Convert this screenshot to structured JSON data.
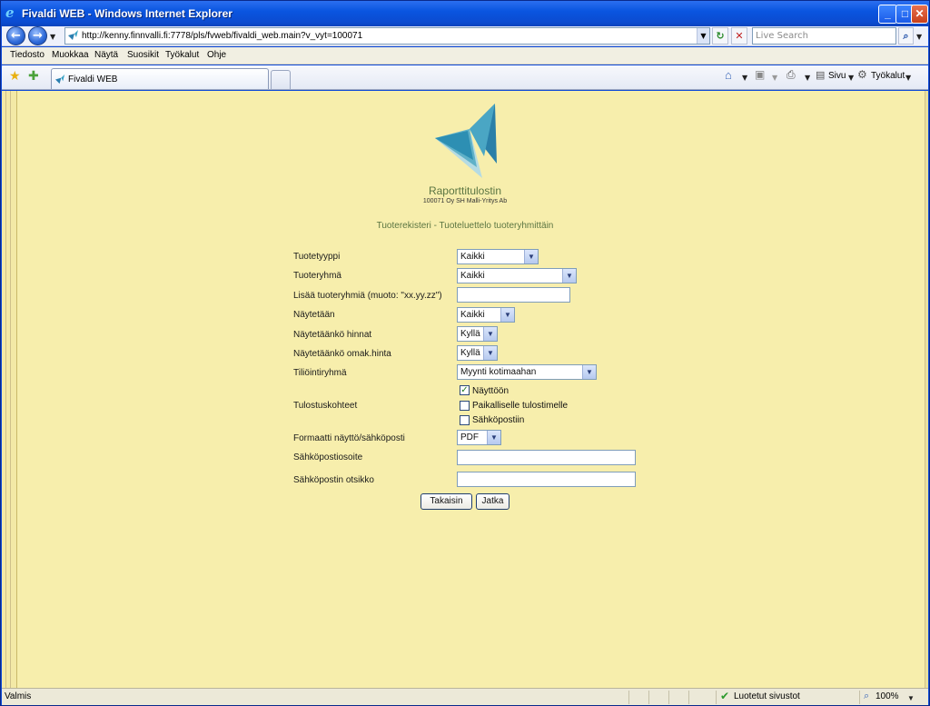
{
  "window": {
    "title": "Fivaldi WEB - Windows Internet Explorer"
  },
  "address": {
    "url": "http://kenny.finnvalli.fi:7778/pls/fvweb/fivaldi_web.main?v_vyt=100071",
    "search_placeholder": "Live Search"
  },
  "menu": {
    "items": [
      "Tiedosto",
      "Muokkaa",
      "Näytä",
      "Suosikit",
      "Työkalut",
      "Ohje"
    ]
  },
  "tabs": {
    "active_label": "Fivaldi WEB"
  },
  "commandbar": {
    "page_label": "Sivu",
    "tools_label": "Työkalut"
  },
  "report": {
    "title": "Raporttitulostin",
    "company": "100071 Oy SH Malli-Yritys Ab",
    "subtitle": "Tuoterekisteri - Tuoteluettelo tuoteryhmittäin"
  },
  "form": {
    "tuotetyyppi": {
      "label": "Tuotetyyppi",
      "value": "Kaikki"
    },
    "tuoteryhma": {
      "label": "Tuoteryhmä",
      "value": "Kaikki"
    },
    "lisaa": {
      "label": "Lisää tuoteryhmiä (muoto: \"xx.yy.zz\")",
      "value": ""
    },
    "naytetaan": {
      "label": "Näytetään",
      "value": "Kaikki"
    },
    "hinnat": {
      "label": "Näytetäänkö hinnat",
      "value": "Kyllä"
    },
    "omakhinta": {
      "label": "Näytetäänkö omak.hinta",
      "value": "Kyllä"
    },
    "tiliointiryhma": {
      "label": "Tiliöintiryhmä",
      "value": "Myynti kotimaahan"
    },
    "tulostuskohteet": {
      "label": "Tulostuskohteet",
      "options": [
        {
          "label": "Näyttöön",
          "checked": true
        },
        {
          "label": "Paikalliselle tulostimelle",
          "checked": false
        },
        {
          "label": "Sähköpostiin",
          "checked": false
        }
      ]
    },
    "formaatti": {
      "label": "Formaatti näyttö/sähköposti",
      "value": "PDF"
    },
    "sahkopostiosoite": {
      "label": "Sähköpostiosoite",
      "value": ""
    },
    "otsikko": {
      "label": "Sähköpostin otsikko",
      "value": ""
    }
  },
  "buttons": {
    "back": "Takaisin",
    "next": "Jatka"
  },
  "status": {
    "left": "Valmis",
    "zone": "Luotetut sivustot",
    "zoom": "100%"
  }
}
